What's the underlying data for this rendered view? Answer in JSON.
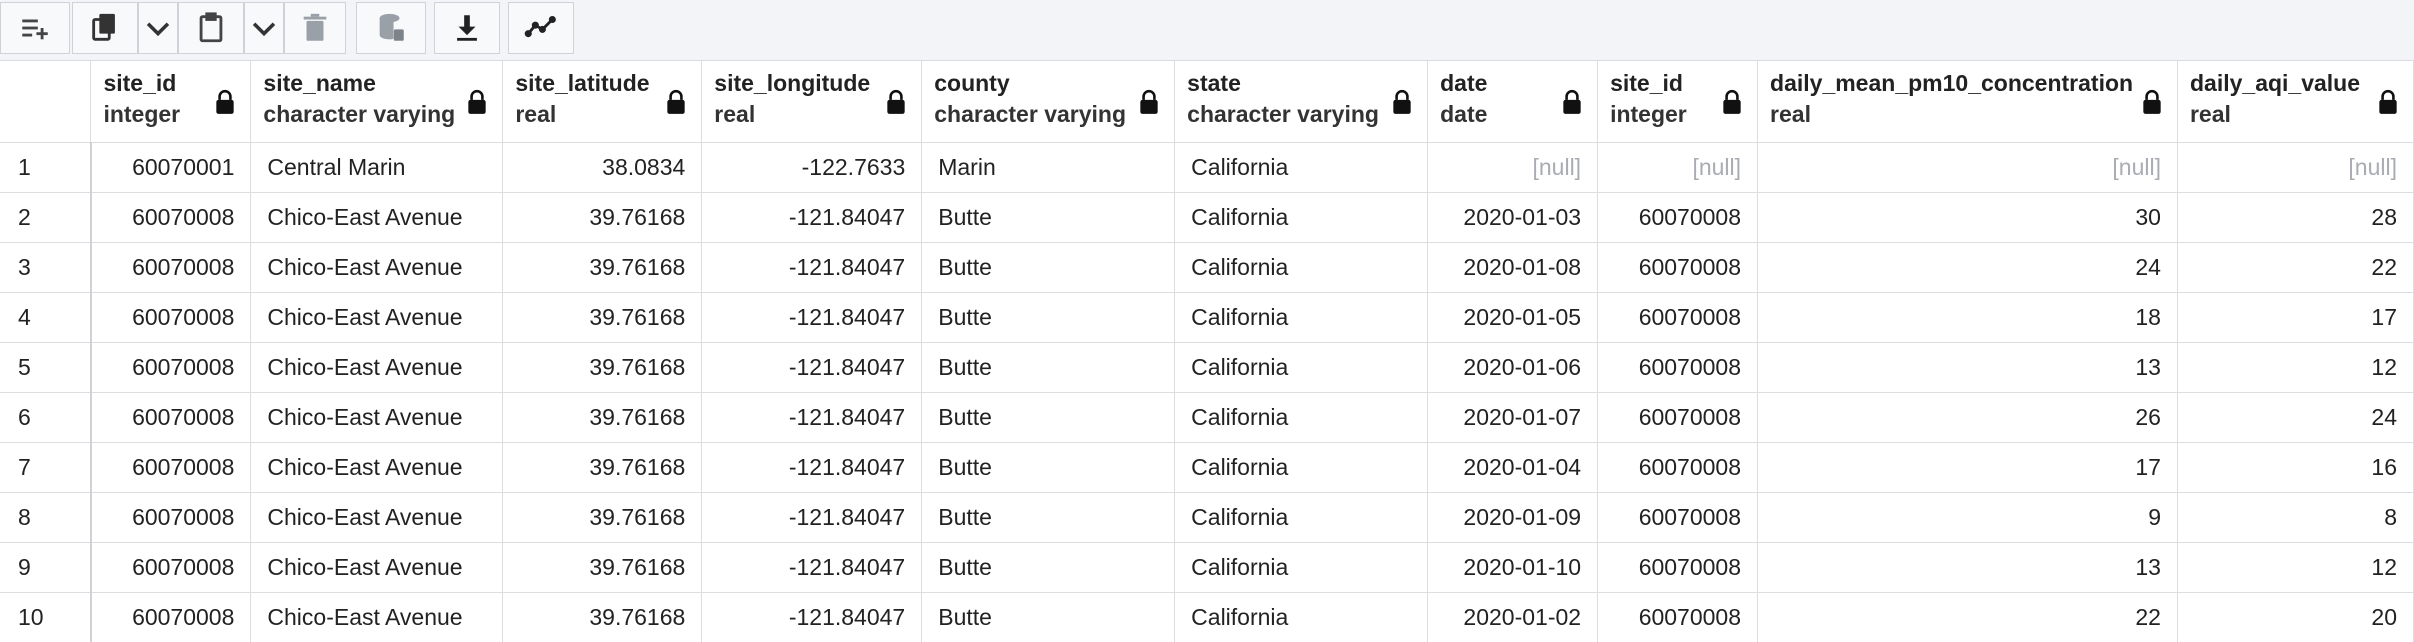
{
  "toolbar": {
    "buttons": [
      {
        "name": "add-row-button",
        "icon": "add-row-icon"
      },
      {
        "name": "copy-button",
        "icon": "copy-icon"
      },
      {
        "name": "copy-options-dropdown",
        "icon": "chevron-down-icon"
      },
      {
        "name": "paste-button",
        "icon": "paste-icon"
      },
      {
        "name": "paste-options-dropdown",
        "icon": "chevron-down-icon"
      },
      {
        "name": "delete-button",
        "icon": "trash-icon"
      },
      {
        "name": "save-data-button",
        "icon": "database-icon"
      },
      {
        "name": "download-button",
        "icon": "download-icon"
      },
      {
        "name": "graph-button",
        "icon": "line-chart-icon"
      }
    ]
  },
  "columns": [
    {
      "name": "site_id",
      "type": "integer"
    },
    {
      "name": "site_name",
      "type": "character varying"
    },
    {
      "name": "site_latitude",
      "type": "real"
    },
    {
      "name": "site_longitude",
      "type": "real"
    },
    {
      "name": "county",
      "type": "character varying"
    },
    {
      "name": "state",
      "type": "character varying"
    },
    {
      "name": "date",
      "type": "date"
    },
    {
      "name": "site_id",
      "type": "integer"
    },
    {
      "name": "daily_mean_pm10_concentration",
      "type": "real"
    },
    {
      "name": "daily_aqi_value",
      "type": "real"
    }
  ],
  "rows": [
    {
      "n": "1",
      "cells": [
        "60070001",
        "Central Marin",
        "38.0834",
        "-122.7633",
        "Marin",
        "California",
        "[null]",
        "[null]",
        "[null]",
        "[null]"
      ]
    },
    {
      "n": "2",
      "cells": [
        "60070008",
        "Chico-East Avenue",
        "39.76168",
        "-121.84047",
        "Butte",
        "California",
        "2020-01-03",
        "60070008",
        "30",
        "28"
      ]
    },
    {
      "n": "3",
      "cells": [
        "60070008",
        "Chico-East Avenue",
        "39.76168",
        "-121.84047",
        "Butte",
        "California",
        "2020-01-08",
        "60070008",
        "24",
        "22"
      ]
    },
    {
      "n": "4",
      "cells": [
        "60070008",
        "Chico-East Avenue",
        "39.76168",
        "-121.84047",
        "Butte",
        "California",
        "2020-01-05",
        "60070008",
        "18",
        "17"
      ]
    },
    {
      "n": "5",
      "cells": [
        "60070008",
        "Chico-East Avenue",
        "39.76168",
        "-121.84047",
        "Butte",
        "California",
        "2020-01-06",
        "60070008",
        "13",
        "12"
      ]
    },
    {
      "n": "6",
      "cells": [
        "60070008",
        "Chico-East Avenue",
        "39.76168",
        "-121.84047",
        "Butte",
        "California",
        "2020-01-07",
        "60070008",
        "26",
        "24"
      ]
    },
    {
      "n": "7",
      "cells": [
        "60070008",
        "Chico-East Avenue",
        "39.76168",
        "-121.84047",
        "Butte",
        "California",
        "2020-01-04",
        "60070008",
        "17",
        "16"
      ]
    },
    {
      "n": "8",
      "cells": [
        "60070008",
        "Chico-East Avenue",
        "39.76168",
        "-121.84047",
        "Butte",
        "California",
        "2020-01-09",
        "60070008",
        "9",
        "8"
      ]
    },
    {
      "n": "9",
      "cells": [
        "60070008",
        "Chico-East Avenue",
        "39.76168",
        "-121.84047",
        "Butte",
        "California",
        "2020-01-10",
        "60070008",
        "13",
        "12"
      ]
    },
    {
      "n": "10",
      "cells": [
        "60070008",
        "Chico-East Avenue",
        "39.76168",
        "-121.84047",
        "Butte",
        "California",
        "2020-01-02",
        "60070008",
        "22",
        "20"
      ]
    }
  ]
}
